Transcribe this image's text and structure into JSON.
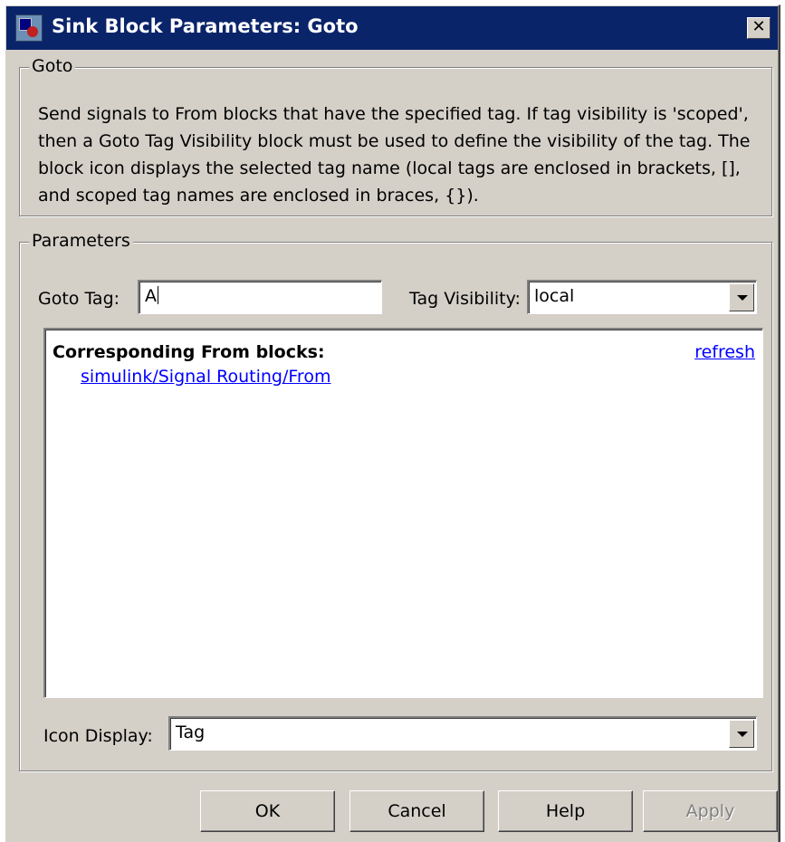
{
  "window": {
    "title": "Sink Block Parameters: Goto",
    "close_glyph": "✕"
  },
  "goto_section": {
    "legend": "Goto",
    "description": "Send signals to From blocks that have the specified tag.  If tag visibility is 'scoped', then a Goto Tag Visibility block must be used to define the visibility of the tag.  The block icon displays the selected tag name (local tags are enclosed in brackets, [], and scoped tag names are enclosed in braces, {})."
  },
  "parameters": {
    "legend": "Parameters",
    "goto_tag_label": "Goto Tag:",
    "goto_tag_value": "A",
    "tag_visibility_label": "Tag Visibility:",
    "tag_visibility_value": "local",
    "corresponding_title": "Corresponding From blocks:",
    "refresh_link": "refresh",
    "from_blocks": [
      "simulink/Signal Routing/From"
    ],
    "icon_display_label": "Icon Display:",
    "icon_display_value": "Tag"
  },
  "buttons": {
    "ok": "OK",
    "cancel": "Cancel",
    "help": "Help",
    "apply": "Apply"
  },
  "colors": {
    "titlebar": "#0a246a",
    "dialog_bg": "#d4d0c8",
    "link": "#0000ff"
  },
  "icons": {
    "title_icon": "simulink-block-icon",
    "dropdown_arrow": "chevron-down-icon"
  }
}
